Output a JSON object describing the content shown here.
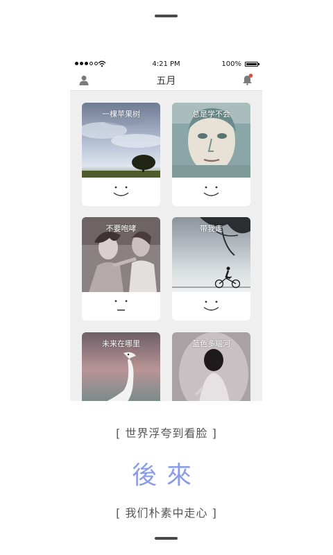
{
  "status_bar": {
    "time": "4:21 PM",
    "battery": "100%"
  },
  "nav": {
    "title": "五月",
    "left_icon": "user-icon",
    "right_icon": "bell-icon",
    "badge_color": "#e8453c"
  },
  "cards": [
    {
      "title": "一棵苹果树",
      "face": "smile"
    },
    {
      "title": "总是学不会",
      "face": "smile"
    },
    {
      "title": "不要咆哮",
      "face": "neutral"
    },
    {
      "title": "带我走",
      "face": "smile"
    },
    {
      "title": "未来在哪里",
      "face": ""
    },
    {
      "title": "蓝色多瑙河",
      "face": ""
    }
  ],
  "footer": {
    "tagline_top": "[ 世界浮夸到看脸 ]",
    "logo": "後來",
    "tagline_bottom": "[ 我们朴素中走心 ]",
    "logo_color": "#8a9ce8"
  }
}
